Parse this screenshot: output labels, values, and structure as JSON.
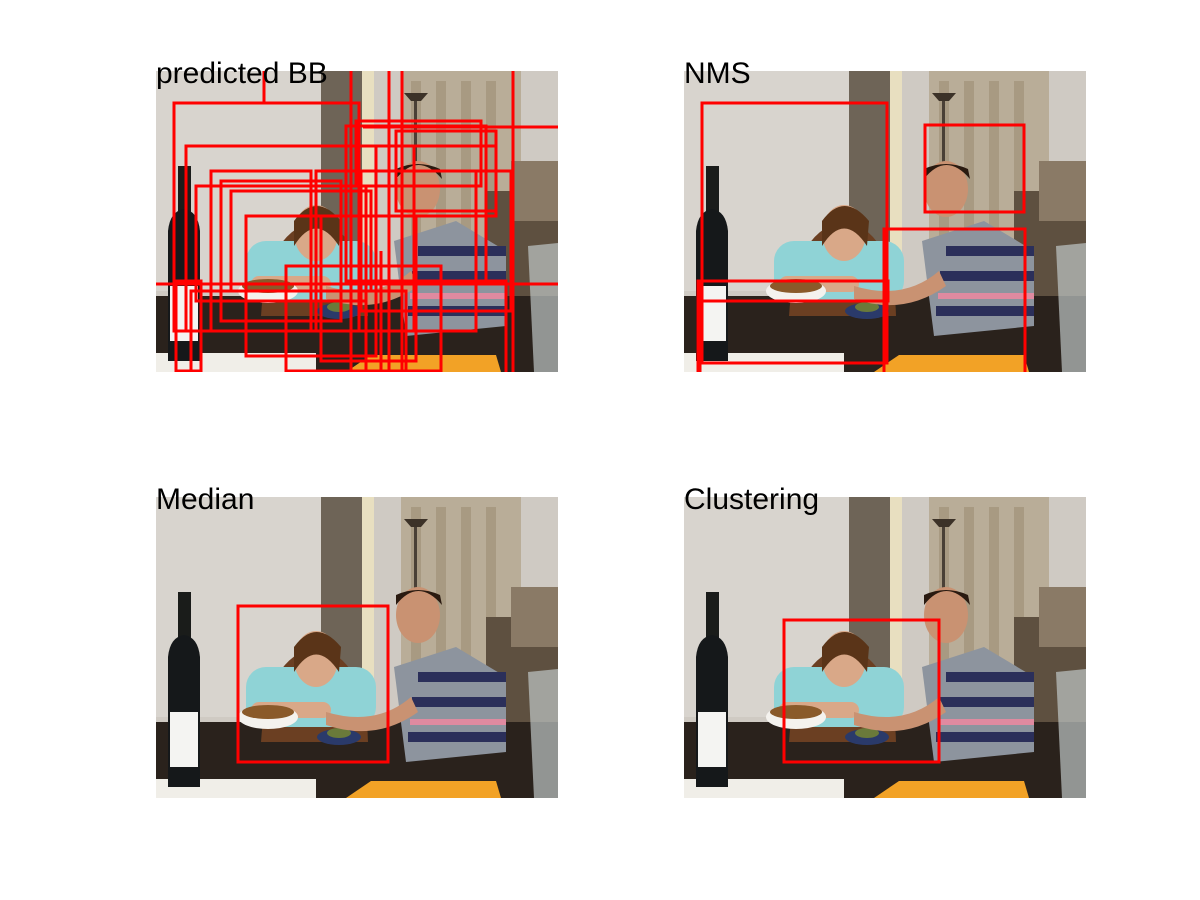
{
  "figure": {
    "box_color": "#ff0000",
    "panels": [
      {
        "id": "predicted",
        "title": "predicted BB"
      },
      {
        "id": "nms",
        "title": "NMS"
      },
      {
        "id": "median",
        "title": "Median"
      },
      {
        "id": "clustering",
        "title": "Clustering"
      }
    ]
  }
}
